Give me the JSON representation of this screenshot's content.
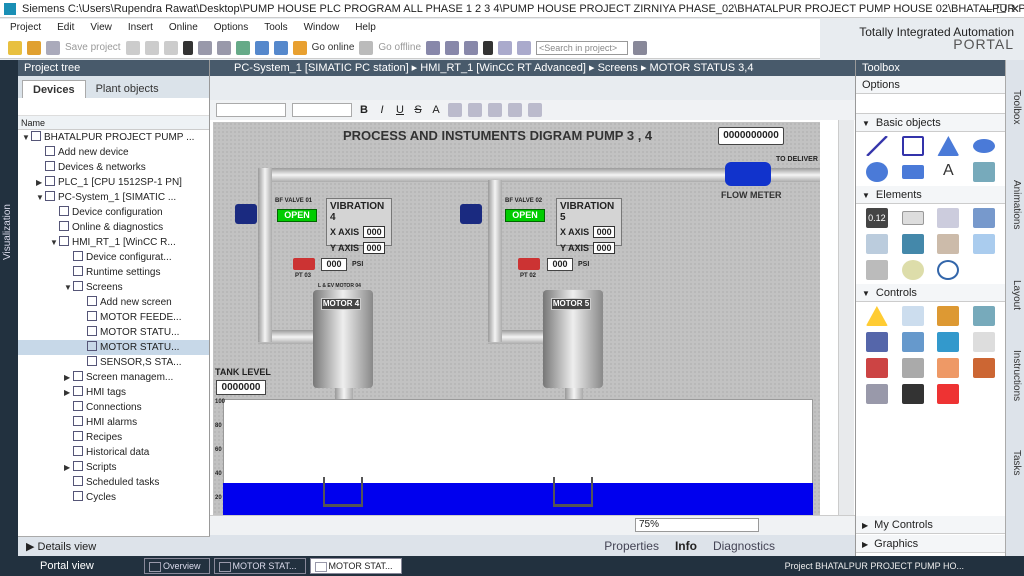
{
  "titlebar": {
    "app": "Siemens",
    "path": "C:\\Users\\Rupendra Rawat\\Desktop\\PUMP HOUSE PLC PROGRAM ALL PHASE 1 2 3 4\\PUMP HOUSE PROJECT ZIRNIYA PHASE_02\\BHATALPUR PROJECT PUMP HOUSE 02\\BHATALPUR PRO..."
  },
  "menu": [
    "Project",
    "Edit",
    "View",
    "Insert",
    "Online",
    "Options",
    "Tools",
    "Window",
    "Help"
  ],
  "brand": {
    "line1": "Totally Integrated Automation",
    "line2": "PORTAL"
  },
  "toolbar": {
    "save_project": "Save project",
    "go_online": "Go online",
    "go_offline": "Go offline",
    "search_placeholder": "<Search in project>"
  },
  "left_strip": {
    "label": "Visualization"
  },
  "project_tree": {
    "title": "Project tree",
    "tabs": [
      "Devices",
      "Plant objects"
    ],
    "column": "Name",
    "items": [
      {
        "label": "BHATALPUR PROJECT PUMP ...",
        "indent": 0,
        "arrow": "▼"
      },
      {
        "label": "Add new device",
        "indent": 1,
        "arrow": ""
      },
      {
        "label": "Devices & networks",
        "indent": 1,
        "arrow": ""
      },
      {
        "label": "PLC_1 [CPU 1512SP-1 PN]",
        "indent": 1,
        "arrow": "▶"
      },
      {
        "label": "PC-System_1 [SIMATIC ...",
        "indent": 1,
        "arrow": "▼"
      },
      {
        "label": "Device configuration",
        "indent": 2,
        "arrow": ""
      },
      {
        "label": "Online & diagnostics",
        "indent": 2,
        "arrow": ""
      },
      {
        "label": "HMI_RT_1 [WinCC R...",
        "indent": 2,
        "arrow": "▼"
      },
      {
        "label": "Device configurat...",
        "indent": 3,
        "arrow": ""
      },
      {
        "label": "Runtime settings",
        "indent": 3,
        "arrow": ""
      },
      {
        "label": "Screens",
        "indent": 3,
        "arrow": "▼"
      },
      {
        "label": "Add new screen",
        "indent": 4,
        "arrow": ""
      },
      {
        "label": "MOTOR FEEDE...",
        "indent": 4,
        "arrow": ""
      },
      {
        "label": "MOTOR STATU...",
        "indent": 4,
        "arrow": ""
      },
      {
        "label": "MOTOR STATU...",
        "indent": 4,
        "arrow": "",
        "selected": true
      },
      {
        "label": "SENSOR,S STA...",
        "indent": 4,
        "arrow": ""
      },
      {
        "label": "Screen managem...",
        "indent": 3,
        "arrow": "▶"
      },
      {
        "label": "HMI tags",
        "indent": 3,
        "arrow": "▶"
      },
      {
        "label": "Connections",
        "indent": 3,
        "arrow": ""
      },
      {
        "label": "HMI alarms",
        "indent": 3,
        "arrow": ""
      },
      {
        "label": "Recipes",
        "indent": 3,
        "arrow": ""
      },
      {
        "label": "Historical data",
        "indent": 3,
        "arrow": ""
      },
      {
        "label": "Scripts",
        "indent": 3,
        "arrow": "▶"
      },
      {
        "label": "Scheduled tasks",
        "indent": 3,
        "arrow": ""
      },
      {
        "label": "Cycles",
        "indent": 3,
        "arrow": ""
      }
    ],
    "details_view": "Details view"
  },
  "breadcrumb": "PC-System_1 [SIMATIC PC station]  ▸  HMI_RT_1 [WinCC RT Advanced]  ▸  Screens  ▸  MOTOR STATUS 3,4",
  "format_bar": [
    "B",
    "I",
    "U",
    "S",
    "A"
  ],
  "hmi": {
    "title": "PROCESS AND INSTUMENTS DIGRAM PUMP 3 , 4",
    "flow_display": "0000000000",
    "to_deliver": "TO DELIVER",
    "flow_meter": "FLOW METER",
    "valve1": "BF VALVE 01",
    "valve2": "BF VALVE 02",
    "open": "OPEN",
    "vib1": {
      "title": "VIBRATION 4",
      "x": "X AXIS",
      "y": "Y AXIS",
      "xv": "000",
      "yv": "000"
    },
    "vib2": {
      "title": "VIBRATION 5",
      "x": "X AXIS",
      "y": "Y AXIS",
      "xv": "000",
      "yv": "000"
    },
    "pt1": "PT 03",
    "pt2": "PT 02",
    "psi_val": "000",
    "psi": "PSI",
    "motor4": "MOTOR 4",
    "motor5": "MOTOR 5",
    "motor4_tag": "L & EV MOTOR 04",
    "tank_level": "TANK LEVEL",
    "tank_val": "0000000",
    "ticks": [
      "100",
      "80",
      "60",
      "40",
      "20"
    ],
    "water_level_percent": 30
  },
  "zoom": "75%",
  "inspector_tabs": [
    "Properties",
    "Info",
    "Diagnostics"
  ],
  "toolbox": {
    "title": "Toolbox",
    "sections": [
      "Options",
      "Basic objects",
      "Elements",
      "Controls",
      "My Controls",
      "Graphics"
    ],
    "basic_text_icon": "A",
    "elem_io": "0.12"
  },
  "right_tabs": [
    "Toolbox",
    "Animations",
    "Layout",
    "Instructions",
    "Tasks"
  ],
  "taskbar": {
    "portal": "Portal view",
    "tasks": [
      "Overview",
      "MOTOR STAT...",
      "MOTOR STAT..."
    ],
    "status": "Project BHATALPUR PROJECT PUMP HO..."
  }
}
